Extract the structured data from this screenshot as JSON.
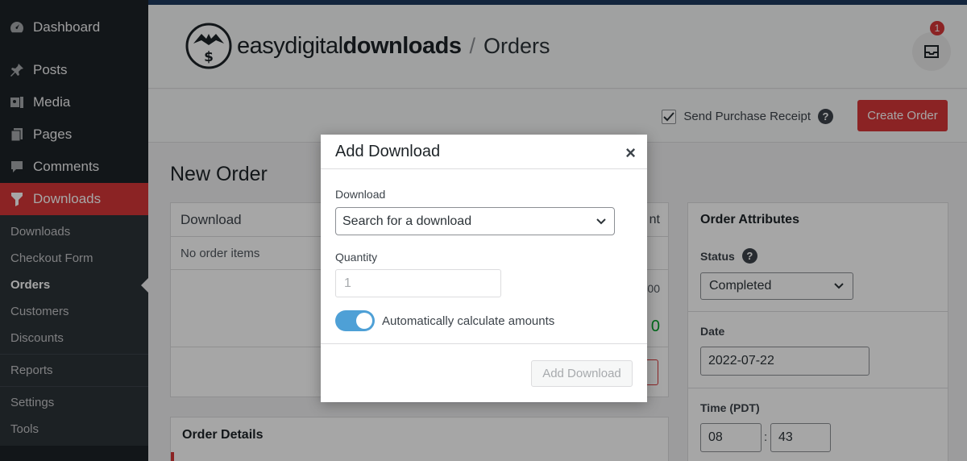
{
  "sidebar": {
    "items": [
      {
        "label": "Dashboard",
        "icon": "dashboard-icon"
      },
      {
        "label": "Posts",
        "icon": "pin-icon"
      },
      {
        "label": "Media",
        "icon": "media-icon"
      },
      {
        "label": "Pages",
        "icon": "pages-icon"
      },
      {
        "label": "Comments",
        "icon": "comments-icon"
      },
      {
        "label": "Downloads",
        "icon": "download-icon"
      }
    ],
    "submenu": [
      "Downloads",
      "Checkout Form",
      "Orders",
      "Customers",
      "Discounts"
    ],
    "reports": "Reports",
    "settings": "Settings",
    "tools": "Tools"
  },
  "header": {
    "logo_light1": "easy",
    "logo_light2": "digital",
    "logo_bold": "downloads",
    "separator": "/",
    "page": "Orders",
    "badge_count": "1"
  },
  "actionbar": {
    "receipt_label": "Send Purchase Receipt",
    "help": "?",
    "create_label": "Create Order"
  },
  "main": {
    "title": "New Order",
    "items_panel": {
      "head": "Download",
      "amount_partial": "nt",
      "empty": "No order items",
      "val1_partial": "00",
      "val2_partial": "0"
    },
    "details_title": "Order Details",
    "attributes": {
      "title": "Order Attributes",
      "status_label": "Status",
      "status_value": "Completed",
      "date_label": "Date",
      "date_value": "2022-07-22",
      "time_label": "Time (PDT)",
      "hour": "08",
      "colon": ":",
      "minute": "43"
    }
  },
  "modal": {
    "title": "Add Download",
    "close": "×",
    "download_label": "Download",
    "download_placeholder": "Search for a download",
    "quantity_label": "Quantity",
    "quantity_value": "1",
    "auto_label": "Automatically calculate amounts",
    "submit_label": "Add Download"
  },
  "colors": {
    "accent": "#d63638",
    "toggle": "#4ea0d6",
    "sidebar": "#1d2327"
  }
}
